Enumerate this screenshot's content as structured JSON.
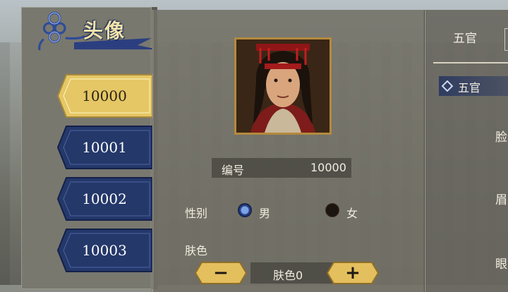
{
  "header": {
    "title": "头像"
  },
  "avatar_list": {
    "items": [
      {
        "label": "10000",
        "selected": true
      },
      {
        "label": "10001",
        "selected": false
      },
      {
        "label": "10002",
        "selected": false
      },
      {
        "label": "10003",
        "selected": false
      }
    ]
  },
  "detail": {
    "id_label": "编号",
    "id_value": "10000",
    "gender_label": "性别",
    "gender_options": [
      {
        "label": "男",
        "selected": true
      },
      {
        "label": "女",
        "selected": false
      }
    ],
    "skin_label": "肤色",
    "skin_value": "肤色0"
  },
  "features_panel": {
    "tab_label": "五官",
    "section_label": "五官",
    "side_labels": [
      "脸",
      "眉",
      "眼"
    ]
  },
  "colors": {
    "selected_item": "#e6c766",
    "unselected_item": "#24386a",
    "button_gold": "#e4bf5d",
    "accent_blue": "#2c3a60"
  }
}
